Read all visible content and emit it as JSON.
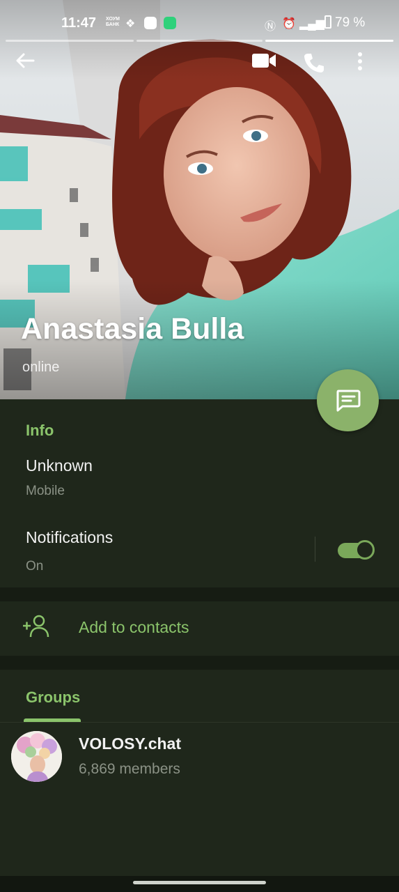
{
  "status_bar": {
    "time": "11:47",
    "bank_line1": "ХОУМ",
    "bank_line2": "БАНК",
    "battery": "79 %"
  },
  "toolbar": {
    "back_icon": "arrow-left-icon",
    "video_icon": "video-camera-icon",
    "call_icon": "phone-icon",
    "more_icon": "more-vertical-icon"
  },
  "profile": {
    "name": "Anastasia Bulla",
    "status": "online"
  },
  "info": {
    "title": "Info",
    "phone_value": "Unknown",
    "phone_label": "Mobile",
    "notifications_label": "Notifications",
    "notifications_value": "On",
    "notifications_enabled": true
  },
  "actions": {
    "add_contact_label": "Add to contacts"
  },
  "groups": {
    "tab_label": "Groups",
    "items": [
      {
        "name": "VOLOSY.chat",
        "members": "6,869 members"
      }
    ]
  },
  "colors": {
    "accent": "#8bc46b",
    "fab": "#8bb26a",
    "background": "#1f271b"
  }
}
